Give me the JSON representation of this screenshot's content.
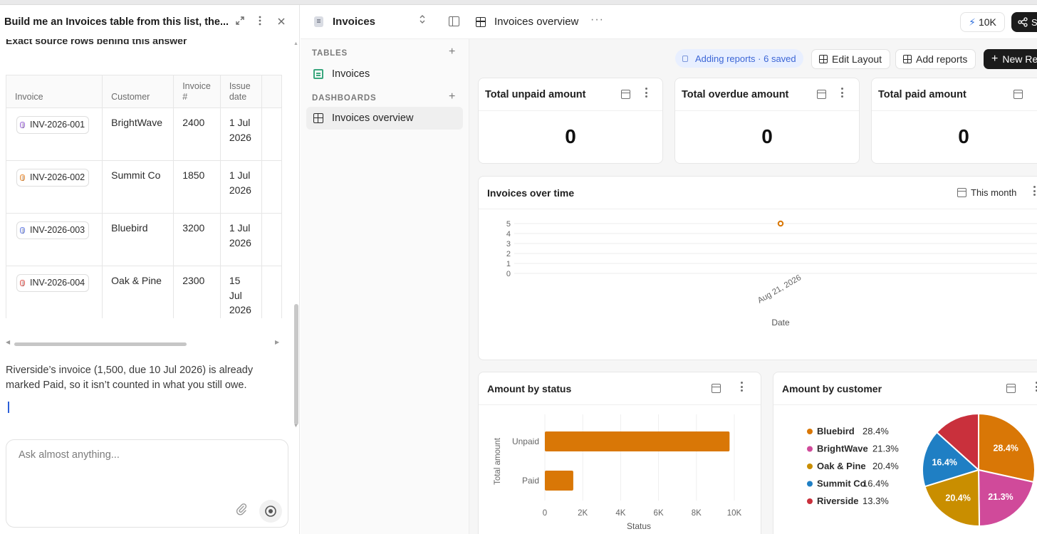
{
  "chat": {
    "title": "Build me an Invoices table from this list, the...",
    "source_heading": "Exact source rows behind this answer",
    "table": {
      "columns": [
        "Invoice",
        "Customer",
        "Invoice #",
        "Issue date"
      ],
      "rows": [
        {
          "invoice": "INV-2026-001",
          "customer": "BrightWave",
          "number": "2400",
          "issue_date": "1 Jul 2026",
          "dot_color": "#a070d8"
        },
        {
          "invoice": "INV-2026-002",
          "customer": "Summit Co",
          "number": "1850",
          "issue_date": "1 Jul 2026",
          "dot_color": "#e88f3a"
        },
        {
          "invoice": "INV-2026-003",
          "customer": "Bluebird",
          "number": "3200",
          "issue_date": "1 Jul 2026",
          "dot_color": "#6f85e6"
        },
        {
          "invoice": "INV-2026-004",
          "customer": "Oak & Pine",
          "number": "2300",
          "issue_date": "15 Jul 2026",
          "dot_color": "#e0605a"
        }
      ]
    },
    "answer": "Riverside’s invoice (1,500, due 10 Jul 2026) is already marked Paid, so it isn’t counted in what you still owe.",
    "composer_placeholder": "Ask almost anything..."
  },
  "sidebar": {
    "db_name": "Invoices",
    "tables_label": "TABLES",
    "tables": [
      "Invoices"
    ],
    "dashboards_label": "DASHBOARDS",
    "dashboards": [
      "Invoices overview"
    ]
  },
  "main": {
    "page_title": "Invoices overview",
    "credits": "10K",
    "share_label": "S",
    "toolbar": {
      "adding_reports": "Adding reports · 6 saved",
      "edit_layout": "Edit Layout",
      "add_reports": "Add reports",
      "new_report": "New Re"
    },
    "kpis": [
      {
        "title": "Total unpaid amount",
        "value": "0"
      },
      {
        "title": "Total overdue amount",
        "value": "0"
      },
      {
        "title": "Total paid amount",
        "value": "0"
      }
    ],
    "line_card": {
      "title": "Invoices over time",
      "range": "This month"
    },
    "bar_card": {
      "title": "Amount by status"
    },
    "pie_card": {
      "title": "Amount by customer"
    }
  },
  "colors": {
    "accent_orange": "#d97706",
    "pie": [
      "#d97706",
      "#d04a9a",
      "#c98e00",
      "#1f7fc4",
      "#c9303c"
    ]
  },
  "chart_data": [
    {
      "type": "line",
      "title": "Invoices over time",
      "xlabel": "Date",
      "ylabel": "",
      "x": [
        "Aug 21, 2026"
      ],
      "series": [
        {
          "values": [
            5
          ]
        }
      ],
      "ylim": [
        0,
        5
      ],
      "yticks": [
        "0",
        "1",
        "2",
        "3",
        "4",
        "5"
      ],
      "grid": true
    },
    {
      "type": "bar",
      "orientation": "horizontal",
      "title": "Amount by status",
      "categories": [
        "Unpaid",
        "Paid"
      ],
      "values": [
        9750,
        1500
      ],
      "xlabel": "Status",
      "ylabel": "Total amount",
      "xlim": [
        0,
        10000
      ],
      "xticks": [
        "0",
        "2K",
        "4K",
        "6K",
        "8K",
        "10K"
      ]
    },
    {
      "type": "pie",
      "title": "Amount by customer",
      "labels": [
        "Bluebird",
        "BrightWave",
        "Oak & Pine",
        "Summit Co",
        "Riverside"
      ],
      "values": [
        28.4,
        21.3,
        20.4,
        16.4,
        13.3
      ],
      "value_labels": [
        "28.4%",
        "21.3%",
        "20.4%",
        "16.4%",
        "13.3%"
      ],
      "legend": "left"
    }
  ]
}
